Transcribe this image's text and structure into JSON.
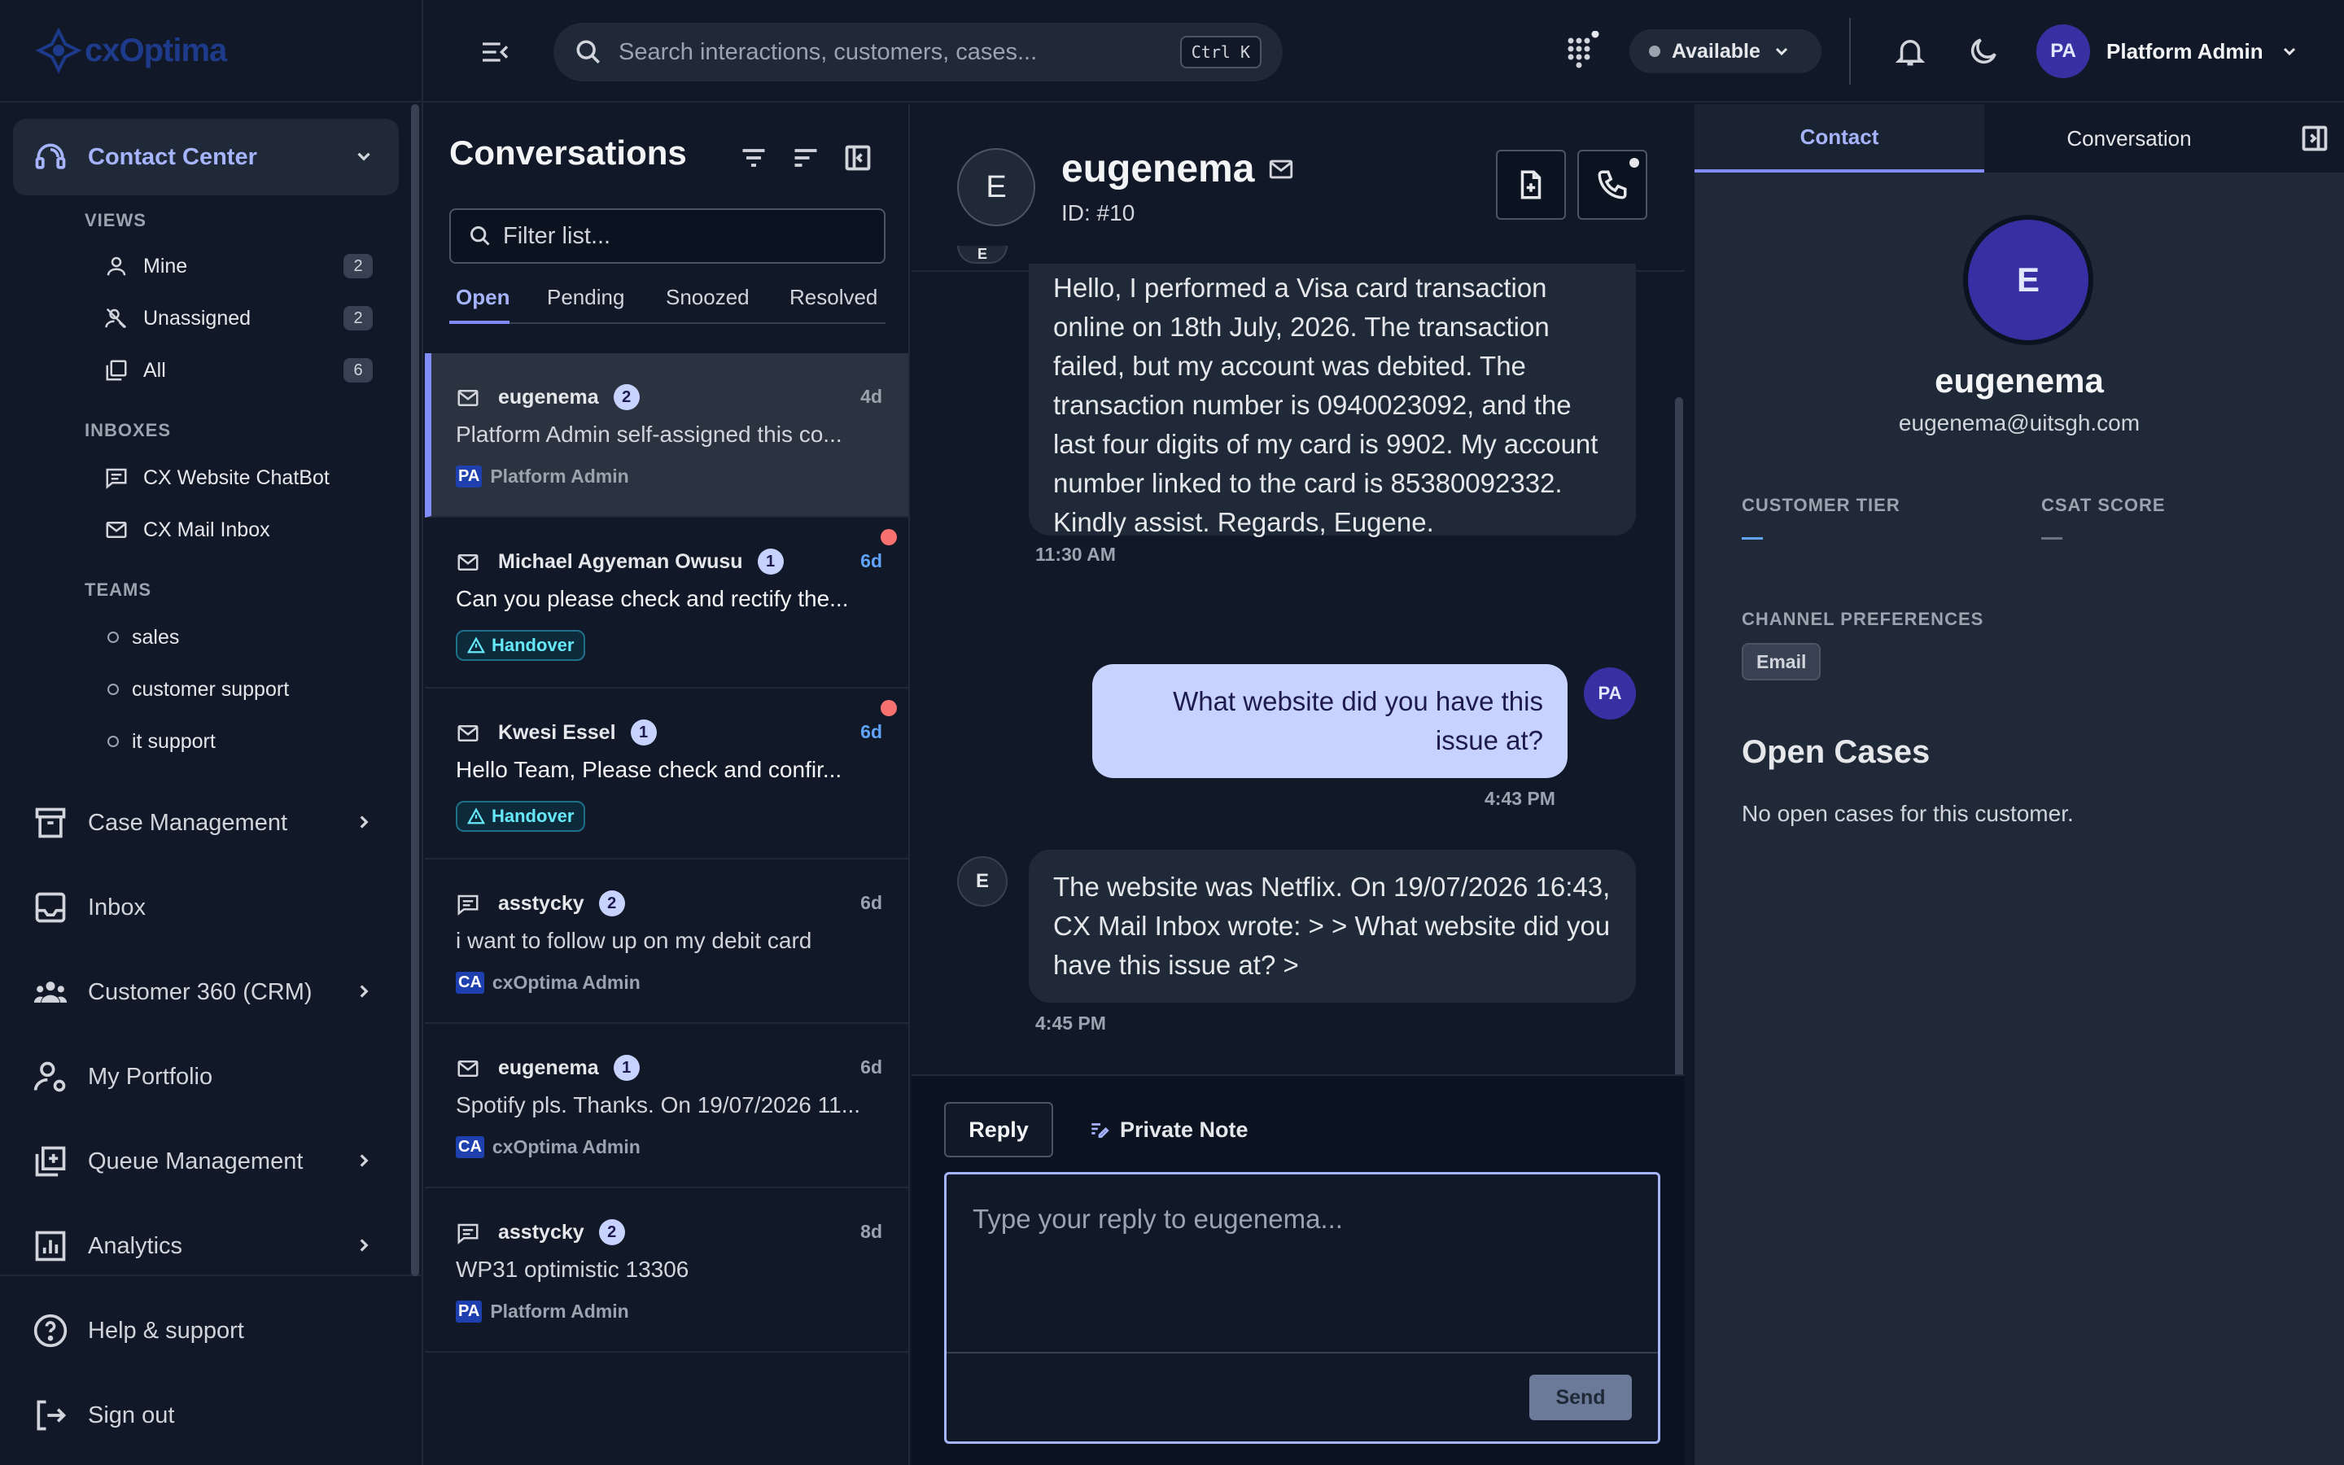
{
  "app": {
    "logo_text": "cxOptima"
  },
  "header": {
    "search_placeholder": "Search interactions, customers, cases...",
    "search_shortcut": "Ctrl K",
    "status_label": "Available",
    "user_initials": "PA",
    "user_name": "Platform Admin"
  },
  "sidebar": {
    "contact_center": "Contact Center",
    "views_heading": "VIEWS",
    "views": [
      {
        "label": "Mine",
        "count": "2"
      },
      {
        "label": "Unassigned",
        "count": "2"
      },
      {
        "label": "All",
        "count": "6"
      }
    ],
    "inboxes_heading": "INBOXES",
    "inboxes": [
      "CX Website ChatBot",
      "CX Mail Inbox"
    ],
    "teams_heading": "TEAMS",
    "teams": [
      "sales",
      "customer support",
      "it support"
    ],
    "nav": [
      "Case Management",
      "Inbox",
      "Customer 360 (CRM)",
      "My Portfolio",
      "Queue Management",
      "Analytics"
    ],
    "help": "Help & support",
    "sign_out": "Sign out"
  },
  "conversations": {
    "title": "Conversations",
    "filter_placeholder": "Filter list...",
    "tabs": [
      "Open",
      "Pending",
      "Snoozed",
      "Resolved"
    ],
    "items": [
      {
        "name": "eugenema",
        "count": "2",
        "time": "4d",
        "message": "Platform Admin self-assigned this co...",
        "assignee_initials": "PA",
        "assignee": "Platform Admin"
      },
      {
        "name": "Michael Agyeman Owusu",
        "count": "1",
        "time": "6d",
        "message": "Can you please check and rectify the...",
        "tag": "Handover"
      },
      {
        "name": "Kwesi Essel",
        "count": "1",
        "time": "6d",
        "message": "Hello Team, Please check and confir...",
        "tag": "Handover"
      },
      {
        "name": "asstycky",
        "count": "2",
        "time": "6d",
        "message": "i want to follow up on my debit card",
        "assignee_initials": "CA",
        "assignee": "cxOptima Admin"
      },
      {
        "name": "eugenema",
        "count": "1",
        "time": "6d",
        "message": "Spotify pls. Thanks. On 19/07/2026 11...",
        "assignee_initials": "CA",
        "assignee": "cxOptima Admin"
      },
      {
        "name": "asstycky",
        "count": "2",
        "time": "8d",
        "message": "WP31 optimistic 13306",
        "assignee_initials": "PA",
        "assignee": "Platform Admin"
      }
    ]
  },
  "chat": {
    "contact_initial": "E",
    "contact_name": "eugenema",
    "contact_id": "ID: #10",
    "partial_avatar": "E",
    "messages": [
      {
        "text": "Hello, I performed a Visa card transaction online on 18th July, 2026. The transaction failed, but my account was debited. The transaction number is 0940023092, and the last four digits of my card is 9902. My account number linked to the card is 85380092332. Kindly assist. Regards, Eugene.",
        "time": "11:30 AM"
      },
      {
        "text": "What website did you have this issue at?",
        "time": "4:43 PM",
        "avatar": "PA"
      },
      {
        "text": "The website was Netflix. On 19/07/2026 16:43, CX Mail Inbox wrote: > > What website did you have this issue at? >",
        "time": "4:45 PM",
        "avatar": "E"
      }
    ],
    "reply_tab": "Reply",
    "note_tab": "Private Note",
    "reply_placeholder": "Type your reply to eugenema...",
    "send_label": "Send"
  },
  "contact_panel": {
    "tabs": [
      "Contact",
      "Conversation"
    ],
    "avatar_initial": "E",
    "name": "eugenema",
    "email": "eugenema@uitsgh.com",
    "tier_label": "CUSTOMER TIER",
    "csat_label": "CSAT SCORE",
    "channel_label": "CHANNEL PREFERENCES",
    "channel_value": "Email",
    "open_cases_title": "Open Cases",
    "open_cases_empty": "No open cases for this customer."
  }
}
